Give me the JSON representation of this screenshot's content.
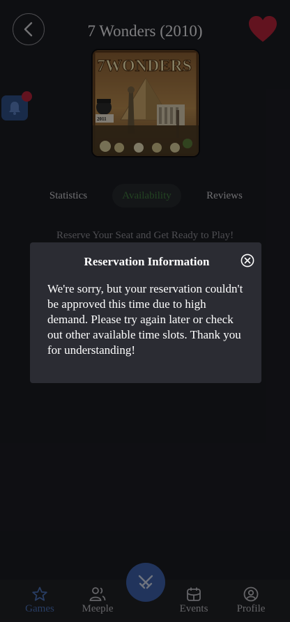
{
  "header": {
    "title": "7 Wonders (2010)",
    "back_icon": "chevron-left-icon",
    "favorite_icon": "heart-icon",
    "favorite_color": "#b3243a"
  },
  "cover": {
    "title_text": "7WONDERS",
    "badge_text": "2011"
  },
  "notification": {
    "icon": "bell-icon",
    "has_badge": true
  },
  "tabs": [
    {
      "label": "Statistics",
      "active": false
    },
    {
      "label": "Availability",
      "active": true
    },
    {
      "label": "Reviews",
      "active": false
    }
  ],
  "availability": {
    "reserve_text": "Reserve Your Seat and Get Ready to Play!"
  },
  "modal": {
    "title": "Reservation Information",
    "close_icon": "close-circle-icon",
    "message": "We're sorry, but your reservation couldn't be approved this time due to high demand. Please try again later or check out other available time slots. Thank you for understanding!"
  },
  "bottom_nav": {
    "items": [
      {
        "label": "Games",
        "icon": "star-icon",
        "active": true
      },
      {
        "label": "Meeple",
        "icon": "people-icon",
        "active": false
      },
      {
        "label": "Events",
        "icon": "calendar-icon",
        "active": false
      },
      {
        "label": "Profile",
        "icon": "user-circle-icon",
        "active": false
      }
    ],
    "center_action_icon": "crossed-swords-icon"
  },
  "colors": {
    "background": "#1b1c22",
    "accent_blue": "#3c5fa8",
    "active_tab_text": "#3f7a3e",
    "modal_background": "#2b2c33"
  }
}
